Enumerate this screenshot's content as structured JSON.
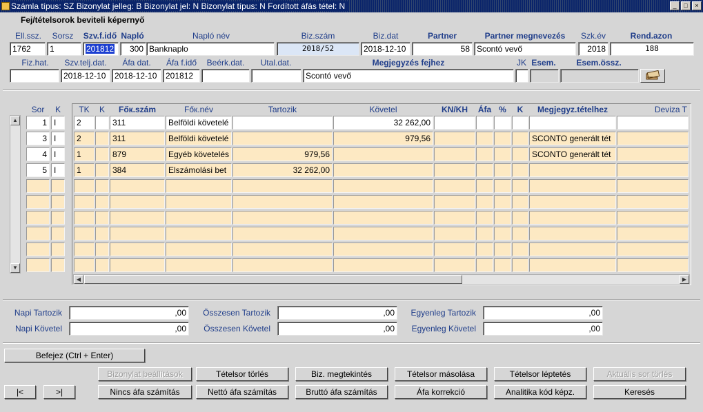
{
  "window": {
    "title": "Számla típus: SZ Bizonylat jelleg: B Bizonylat jel: N Bizonylat típus: N Fordított áfás tétel: N"
  },
  "header": {
    "section_title": "Fej/tételsorok beviteli képernyő",
    "labels": {
      "ell_ssz": "Ell.ssz.",
      "sorsz": "Sorsz",
      "szv_f_ido": "Szv.f.idő",
      "naplo": "Napló",
      "naplo_nev": "Napló név",
      "biz_szam": "Biz.szám",
      "biz_dat": "Biz.dat",
      "partner": "Partner",
      "partner_megnevezes": "Partner megnevezés",
      "szk_ev": "Szk.év",
      "rend_azon": "Rend.azon",
      "fiz_hat": "Fiz.hat.",
      "szv_telj_dat": "Szv.telj.dat.",
      "afa_dat": "Áfa dat.",
      "afa_f_ido": "Áfa f.idő",
      "beerk_dat": "Beérk.dat.",
      "utal_dat": "Utal.dat.",
      "megjegyzes_fejhez": "Megjegyzés fejhez",
      "jk": "JK",
      "esem": "Esem.",
      "esem_ossz": "Esem.össz."
    },
    "values": {
      "ell_ssz": "1762",
      "sorsz": "1",
      "szv_f_ido": "201812",
      "naplo": "300",
      "naplo_nev": "Banknaplo",
      "biz_szam": "2018/52",
      "biz_dat": "2018-12-10",
      "partner": "58",
      "partner_megnevezes": "Scontó vevő",
      "szk_ev": "2018",
      "rend_azon": "188",
      "fiz_hat": "",
      "szv_telj_dat": "2018-12-10",
      "afa_dat": "2018-12-10",
      "afa_f_ido": "201812",
      "beerk_dat": "",
      "utal_dat": "",
      "megjegyzes_fejhez": "Scontó vevő",
      "jk": "",
      "esem": "",
      "esem_ossz": ""
    }
  },
  "grid": {
    "left_headers": {
      "sor": "Sor",
      "k": "K"
    },
    "headers": {
      "tk": "TK",
      "k": "K",
      "fok_szam": "Főк.szám",
      "fok_nev": "Főк.név",
      "tartozik": "Tartozik",
      "kovetel": "Követel",
      "kn_kh": "KN/KH",
      "afa": "Áfa",
      "pct": "%",
      "k2": "K",
      "megjegyz": "Megjegyz.tételhez",
      "deviza": "Deviza T"
    },
    "rows": [
      {
        "sor": "1",
        "k": "I",
        "tk": "2",
        "k1": "",
        "fok_szam": "311",
        "fok_nev": "Belföldi követelé",
        "tartozik": "",
        "kovetel": "32 262,00",
        "kn_kh": "",
        "afa": "",
        "pct": "",
        "k2": "",
        "megjegyz": "",
        "deviza": ""
      },
      {
        "sor": "3",
        "k": "I",
        "tk": "2",
        "k1": "",
        "fok_szam": "311",
        "fok_nev": "Belföldi követelé",
        "tartozik": "",
        "kovetel": "979,56",
        "kn_kh": "",
        "afa": "",
        "pct": "",
        "k2": "",
        "megjegyz": "SCONTO generált tét",
        "deviza": ""
      },
      {
        "sor": "4",
        "k": "I",
        "tk": "1",
        "k1": "",
        "fok_szam": "879",
        "fok_nev": "Egyéb követelés",
        "tartozik": "979,56",
        "kovetel": "",
        "kn_kh": "",
        "afa": "",
        "pct": "",
        "k2": "",
        "megjegyz": "SCONTO generált tét",
        "deviza": ""
      },
      {
        "sor": "5",
        "k": "I",
        "tk": "1",
        "k1": "",
        "fok_szam": "384",
        "fok_nev": "Elszámolási bet",
        "tartozik": "32 262,00",
        "kovetel": "",
        "kn_kh": "",
        "afa": "",
        "pct": "",
        "k2": "",
        "megjegyz": "",
        "deviza": ""
      }
    ]
  },
  "totals": {
    "napi_tartozik_label": "Napi Tartozik",
    "napi_tartozik": ",00",
    "napi_kovetel_label": "Napi Követel",
    "napi_kovetel": ",00",
    "osszesen_tartozik_label": "Összesen Tartozik",
    "osszesen_tartozik": ",00",
    "osszesen_kovetel_label": "Összesen Követel",
    "osszesen_kovetel": ",00",
    "egyenleg_tartozik_label": "Egyenleg Tartozik",
    "egyenleg_tartozik": ",00",
    "egyenleg_kovetel_label": "Egyenleg Követel",
    "egyenleg_kovetel": ",00"
  },
  "buttons": {
    "befejez": "Befejez (Ctrl + Enter)",
    "bizonylat_beallitasok": "Bizonylat beállítások",
    "tetelsor_torles": "Tételsor törlés",
    "biz_megtekintes": "Biz. megtekintés",
    "tetelsor_masolasa": "Tételsor másolása",
    "tetelsor_leptetes": "Tételsor léptetés",
    "aktualis_sor_torles": "Aktuális sor törlés",
    "first": "|<",
    "last": ">|",
    "nincs_afa": "Nincs áfa számítás",
    "netto_afa": "Nettó áfa számítás",
    "brutto_afa": "Bruttó áfa számítás",
    "afa_korrekcio": "Áfa korrekció",
    "analitika": "Analitika kód képz.",
    "kereses": "Keresés"
  },
  "icons": {
    "window_icon": "app-icon",
    "book_button": "books-icon"
  },
  "colors": {
    "grid_cell": "#fde9c3",
    "label_blue": "#1f3d8a",
    "selection": "#1c3fd1",
    "titlebar": "#0a246a"
  }
}
